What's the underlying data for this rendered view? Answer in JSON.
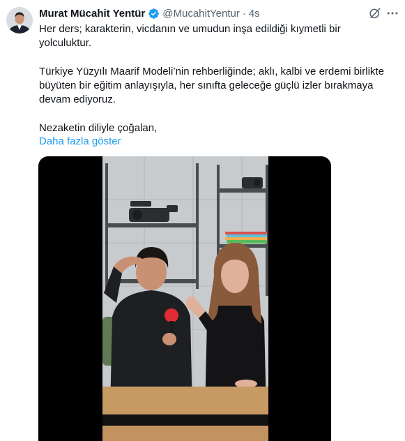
{
  "author": {
    "display_name": "Murat Mücahit Yentür",
    "handle": "@MucahitYentur",
    "separator": "·",
    "time": "4s"
  },
  "tweet": {
    "paragraph1": "Her ders; karakterin, vicdanın ve umudun inşa edildiği kıymetli bir yolculuktur.",
    "paragraph2": "Türkiye Yüzyılı Maarif Modeli’nin rehberliğinde; aklı, kalbi ve erdemi birlikte büyüten bir eğitim anlayışıyla, her sınıfta geleceğe güçlü izler bırakmaya devam ediyoruz.",
    "paragraph3": "Nezaketin diliyle çoğalan,",
    "show_more": "Daha fazla göster"
  },
  "colors": {
    "link": "#1d9bf0",
    "verified": "#1d9bf0",
    "secondary_text": "#536471"
  },
  "icons": {
    "verified": "verified-badge-icon",
    "grok": "grok-icon",
    "more": "more-icon"
  }
}
